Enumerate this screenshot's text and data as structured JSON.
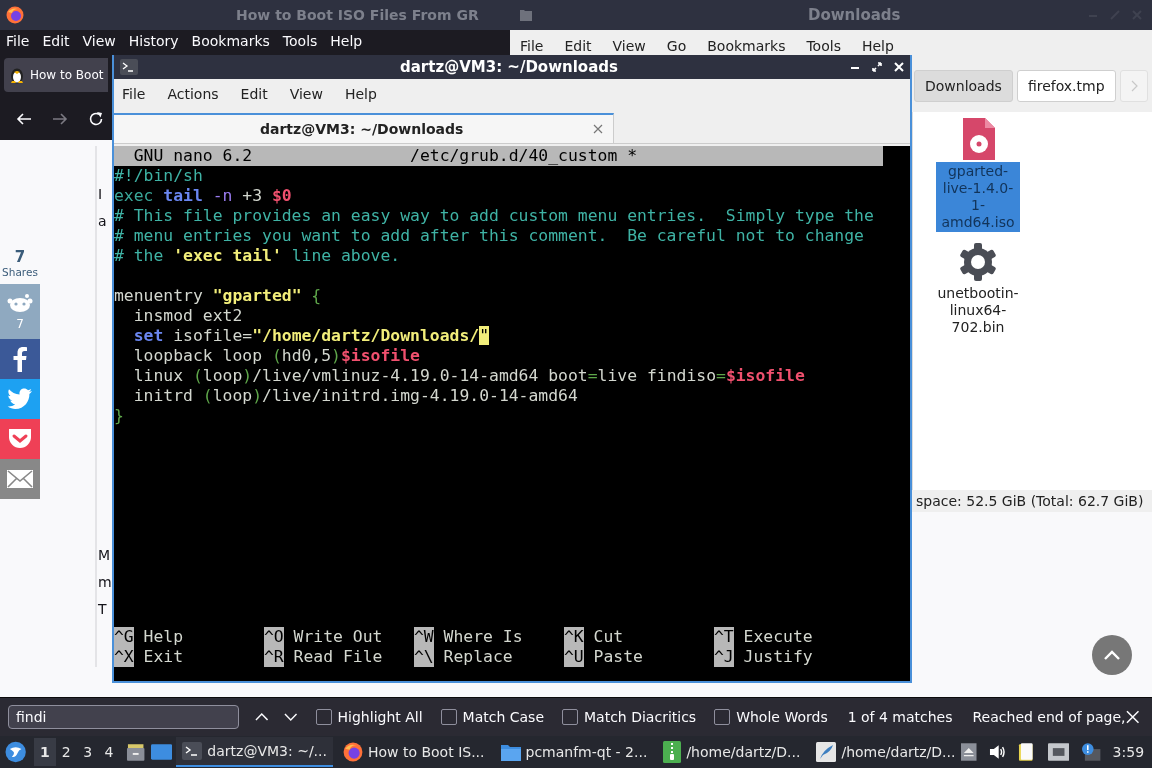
{
  "firefox": {
    "title": "How to Boot ISO Files From GR",
    "menu": [
      "File",
      "Edit",
      "View",
      "History",
      "Bookmarks",
      "Tools",
      "Help"
    ],
    "tab": {
      "title": "How to Boot"
    },
    "page": {
      "share_count": "7",
      "share_label": "Shares",
      "share_buttons": [
        {
          "kind": "reddit",
          "count": "7"
        },
        {
          "kind": "facebook"
        },
        {
          "kind": "twitter"
        },
        {
          "kind": "pocket"
        },
        {
          "kind": "email"
        }
      ],
      "text_fragments_top": [
        "I",
        "a"
      ],
      "text_fragments_bottom": [
        "M",
        "m",
        "T"
      ]
    },
    "find_bar": {
      "value": "findi",
      "options": [
        {
          "label": "Highlight All",
          "checked": false
        },
        {
          "label": "Match Case",
          "checked": false
        },
        {
          "label": "Match Diacritics",
          "checked": false
        },
        {
          "label": "Whole Words",
          "checked": false
        }
      ],
      "match_count": "1 of 4 matches",
      "status": "Reached end of page,"
    }
  },
  "file_manager": {
    "title": "Downloads",
    "menu": [
      "File",
      "Edit",
      "View",
      "Go",
      "Bookmarks",
      "Tools",
      "Help"
    ],
    "path": [
      {
        "label": "Downloads",
        "selected": true
      },
      {
        "label": "firefox.tmp",
        "selected": false
      }
    ],
    "files": [
      {
        "name": "gparted-live-1.4.0-1-amd64.iso",
        "kind": "disc",
        "selected": true
      },
      {
        "name": "unetbootin-linux64-702.bin",
        "kind": "gear",
        "selected": false
      }
    ],
    "status": "space: 52.5 GiB (Total: 62.7 GiB)"
  },
  "terminal": {
    "title": "dartz@VM3: ~/Downloads",
    "menu": [
      "File",
      "Actions",
      "Edit",
      "View",
      "Help"
    ],
    "tab": {
      "title": "dartz@VM3: ~/Downloads"
    },
    "nano": {
      "version": "GNU nano 6.2",
      "file": "/etc/grub.d/40_custom *",
      "lines": [
        {
          "segments": [
            {
              "kind": "comment",
              "text": "#!/bin/sh"
            }
          ]
        },
        {
          "segments": [
            {
              "kind": "cmd",
              "text": "exec "
            },
            {
              "kind": "keyword",
              "text": "tail "
            },
            {
              "kind": "flag",
              "text": "-n"
            },
            {
              "kind": "plain",
              "text": " +3 "
            },
            {
              "kind": "var",
              "text": "$0"
            }
          ]
        },
        {
          "segments": [
            {
              "kind": "comment",
              "text": "# This file provides an easy way to add custom menu entries.  Simply type the"
            }
          ]
        },
        {
          "segments": [
            {
              "kind": "comment",
              "text": "# menu entries you want to add after this comment.  Be careful not to change"
            }
          ]
        },
        {
          "segments": [
            {
              "kind": "comment",
              "text": "# the "
            },
            {
              "kind": "string",
              "text": "'exec tail'"
            },
            {
              "kind": "comment",
              "text": " line above."
            }
          ]
        },
        {
          "segments": [
            {
              "kind": "plain",
              "text": "menuentry "
            },
            {
              "kind": "string",
              "text": "\"gparted\""
            },
            {
              "kind": "paren",
              "text": " {"
            }
          ]
        },
        {
          "segments": [
            {
              "kind": "plain",
              "text": "  insmod ext2"
            }
          ]
        },
        {
          "segments": [
            {
              "kind": "keyword",
              "text": "  set"
            },
            {
              "kind": "plain",
              "text": " isofile="
            },
            {
              "kind": "string",
              "text": "\"/home/dartz/Downloads/"
            },
            {
              "kind": "cursor",
              "text": "\""
            }
          ]
        },
        {
          "segments": [
            {
              "kind": "plain",
              "text": "  loopback loop "
            },
            {
              "kind": "paren",
              "text": "("
            },
            {
              "kind": "plain",
              "text": "hd0,5"
            },
            {
              "kind": "paren",
              "text": ")"
            },
            {
              "kind": "var",
              "text": "$isofile"
            }
          ]
        },
        {
          "segments": [
            {
              "kind": "plain",
              "text": "  linux "
            },
            {
              "kind": "paren",
              "text": "("
            },
            {
              "kind": "plain",
              "text": "loop"
            },
            {
              "kind": "paren",
              "text": ")"
            },
            {
              "kind": "plain",
              "text": "/live/vmlinuz-4.19.0-14-amd64 boot"
            },
            {
              "kind": "paren",
              "text": "="
            },
            {
              "kind": "plain",
              "text": "live findiso"
            },
            {
              "kind": "paren",
              "text": "="
            },
            {
              "kind": "var",
              "text": "$isofile"
            }
          ]
        },
        {
          "segments": [
            {
              "kind": "plain",
              "text": "  initrd "
            },
            {
              "kind": "paren",
              "text": "("
            },
            {
              "kind": "plain",
              "text": "loop"
            },
            {
              "kind": "paren",
              "text": ")"
            },
            {
              "kind": "plain",
              "text": "/live/initrd.img-4.19.0-14-amd64"
            }
          ]
        },
        {
          "segments": [
            {
              "kind": "paren",
              "text": "}"
            }
          ]
        }
      ],
      "shortcuts": [
        {
          "key": "^G",
          "label": "Help"
        },
        {
          "key": "^X",
          "label": "Exit"
        },
        {
          "key": "^O",
          "label": "Write Out"
        },
        {
          "key": "^R",
          "label": "Read File"
        },
        {
          "key": "^W",
          "label": "Where Is"
        },
        {
          "key": "^\\",
          "label": "Replace"
        },
        {
          "key": "^K",
          "label": "Cut"
        },
        {
          "key": "^U",
          "label": "Paste"
        },
        {
          "key": "^T",
          "label": "Execute"
        },
        {
          "key": "^J",
          "label": "Justify"
        }
      ]
    }
  },
  "taskbar": {
    "workspaces": [
      {
        "label": "1",
        "selected": true
      },
      {
        "label": "2",
        "selected": false
      },
      {
        "label": "3",
        "selected": false
      },
      {
        "label": "4",
        "selected": false
      }
    ],
    "tasks": [
      {
        "kind": "terminal",
        "label": "dartz@VM3: ~/...",
        "selected": true
      },
      {
        "kind": "browser",
        "label": "How to Boot IS...",
        "selected": false
      },
      {
        "kind": "folder",
        "label": "pcmanfm-qt - 2...",
        "selected": false
      },
      {
        "kind": "archive",
        "label": "/home/dartz/D...",
        "selected": false
      },
      {
        "kind": "feather",
        "label": "/home/dartz/D...",
        "selected": false
      }
    ],
    "clock": "3:59"
  }
}
